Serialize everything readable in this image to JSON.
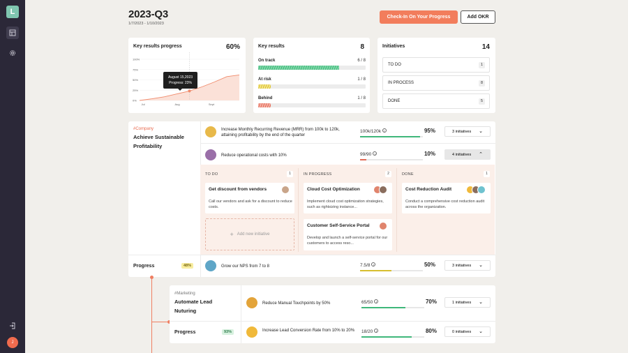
{
  "sidebar": {
    "logo": "L",
    "items": [
      {
        "name": "dashboard-icon"
      },
      {
        "name": "settings-icon"
      }
    ],
    "logout_icon": "logout-icon",
    "avatar_initial": "J"
  },
  "header": {
    "title": "2023-Q3",
    "date_range": "1/7/2023 - 1/10/2023",
    "checkin_label": "Check-In On Your Progress",
    "add_okr_label": "Add OKR"
  },
  "colors": {
    "accent": "#f27d5c",
    "sidebar": "#2b2838",
    "green": "#3fb77a",
    "red": "#e26a55",
    "yellow": "#d7be2f"
  },
  "kr_progress_card": {
    "title": "Key results progress",
    "value": "60%",
    "tooltip_date": "August 15,2023",
    "tooltip_progress": "Progress: 23%",
    "chart_data": {
      "type": "area",
      "x_labels": [
        "Jul",
        "Aug",
        "Sept"
      ],
      "y_labels": [
        "100%",
        "75%",
        "50%",
        "25%",
        "0%"
      ],
      "ylim": [
        0,
        100
      ],
      "series": [
        {
          "values": [
            0,
            4,
            9,
            16,
            23,
            33,
            45,
            58,
            62
          ]
        }
      ],
      "tooltip_index": 4
    }
  },
  "key_results_card": {
    "title": "Key results",
    "total": "8",
    "rows": [
      {
        "label": "On track",
        "count": "6 / 8",
        "fraction": 0.75,
        "style": "green"
      },
      {
        "label": "At risk",
        "count": "1 / 8",
        "fraction": 0.12,
        "style": "yellow"
      },
      {
        "label": "Behind",
        "count": "1 / 8",
        "fraction": 0.12,
        "style": "red"
      }
    ]
  },
  "initiatives_card": {
    "title": "Initiatives",
    "total": "14",
    "rows": [
      {
        "label": "TO DO",
        "count": "1"
      },
      {
        "label": "IN PROCESS",
        "count": "8"
      },
      {
        "label": "DONE",
        "count": "5"
      }
    ]
  },
  "objectives": [
    {
      "tag": "#Company",
      "name": "Achieve Sustainable Profitability",
      "progress_label": "Progress",
      "progress": "48%",
      "key_results": [
        {
          "text": "Increase Monthly Recurring Revenue (MRR) from 100k to 120k, attaining profitability by the end of the quarter",
          "metric": "100k/120k",
          "pct": "95%",
          "fraction": 0.95,
          "bar": "green",
          "initiatives": "3 initiatives"
        },
        {
          "text": "Reduce operational costs with 10%",
          "metric": "99/90",
          "pct": "10%",
          "fraction": 0.1,
          "bar": "red",
          "initiatives": "4 initiatives"
        },
        {
          "text": "Grow our NPS from 7 to 8",
          "metric": "7.5/8",
          "pct": "50%",
          "fraction": 0.5,
          "bar": "yellow",
          "initiatives": "3 initiatives"
        }
      ]
    },
    {
      "tag": "#Marketing",
      "name": "Automate Lead Nuturing",
      "progress_label": "Progress",
      "progress": "93%",
      "key_results": [
        {
          "text": "Reduce Manual Touchpoints by 50%",
          "metric": "65/50",
          "pct": "70%",
          "fraction": 0.7,
          "bar": "green",
          "initiatives": "1 initiatives"
        },
        {
          "text": "Increase Lead Conversion Rate from 10% to 20%",
          "metric": "18/20",
          "pct": "80%",
          "fraction": 0.8,
          "bar": "green",
          "initiatives": "0 initiatives"
        }
      ]
    }
  ],
  "kanban": {
    "columns": [
      {
        "title": "TO DO",
        "count": "1"
      },
      {
        "title": "IN PROGRESS",
        "count": "2"
      },
      {
        "title": "DONE",
        "count": "1"
      }
    ],
    "cards": [
      {
        "title": "Get discount from vendors",
        "desc": "Call our vendors and ask for a discount to reduce costs."
      },
      {
        "title": "Cloud Cost Optimization",
        "desc": "Implement cloud cost optimization strategies, such as rightsizing instance..."
      },
      {
        "title": "Customer Self-Service Portal",
        "desc": "Develop and launch a self-service portal for our customers to access reso..."
      },
      {
        "title": "Cost Reduction Audit",
        "desc": "Conduct a comprehensive cost reduction audit across the organization."
      }
    ],
    "add_new": "Add new initiative"
  }
}
